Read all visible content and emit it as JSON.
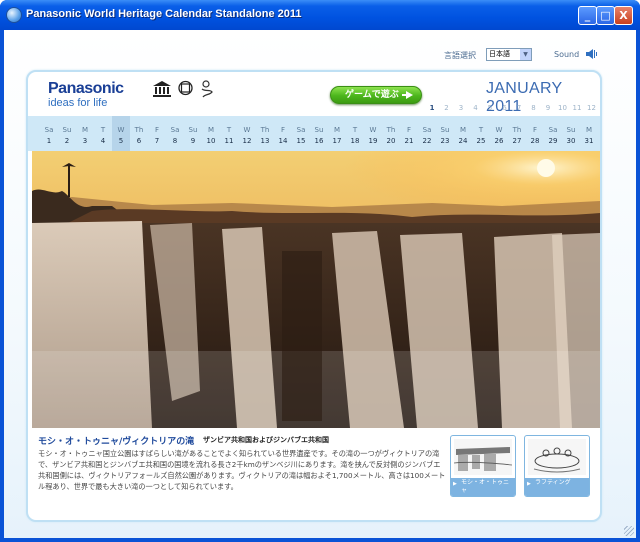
{
  "window": {
    "title": "Panasonic World Heritage Calendar Standalone 2011",
    "min_glyph": "_",
    "max_glyph": "□",
    "close_glyph": "X"
  },
  "header": {
    "lang_label": "言語選択",
    "lang_value": "日本語",
    "sound_label": "Sound"
  },
  "brand": {
    "name": "Panasonic",
    "tagline": "ideas for life",
    "icons": [
      "unesco-logo",
      "world-heritage-emblem",
      "education-logo"
    ]
  },
  "game_button": "ゲームで遊ぶ",
  "calendar": {
    "month_title": "JANUARY 2011",
    "months": [
      "1",
      "2",
      "3",
      "4",
      "5",
      "6",
      "7",
      "8",
      "9",
      "10",
      "11",
      "12"
    ],
    "active_month": "1",
    "days": [
      {
        "w": "Sa",
        "n": "1"
      },
      {
        "w": "Su",
        "n": "2"
      },
      {
        "w": "M",
        "n": "3"
      },
      {
        "w": "T",
        "n": "4"
      },
      {
        "w": "W",
        "n": "5",
        "hl": true
      },
      {
        "w": "Th",
        "n": "6"
      },
      {
        "w": "F",
        "n": "7"
      },
      {
        "w": "Sa",
        "n": "8"
      },
      {
        "w": "Su",
        "n": "9"
      },
      {
        "w": "M",
        "n": "10"
      },
      {
        "w": "T",
        "n": "11"
      },
      {
        "w": "W",
        "n": "12"
      },
      {
        "w": "Th",
        "n": "13"
      },
      {
        "w": "F",
        "n": "14"
      },
      {
        "w": "Sa",
        "n": "15"
      },
      {
        "w": "Su",
        "n": "16"
      },
      {
        "w": "M",
        "n": "17"
      },
      {
        "w": "T",
        "n": "18"
      },
      {
        "w": "W",
        "n": "19"
      },
      {
        "w": "Th",
        "n": "20"
      },
      {
        "w": "F",
        "n": "21"
      },
      {
        "w": "Sa",
        "n": "22"
      },
      {
        "w": "Su",
        "n": "23"
      },
      {
        "w": "M",
        "n": "24"
      },
      {
        "w": "T",
        "n": "25"
      },
      {
        "w": "W",
        "n": "26"
      },
      {
        "w": "Th",
        "n": "27"
      },
      {
        "w": "F",
        "n": "28"
      },
      {
        "w": "Sa",
        "n": "29"
      },
      {
        "w": "Su",
        "n": "30"
      },
      {
        "w": "M",
        "n": "31"
      }
    ]
  },
  "caption": {
    "title": "モシ・オ・トゥニャ/ヴィクトリアの滝",
    "country": "ザンビア共和国およびジンバブエ共和国",
    "body": "モシ・オ・トゥニャ国立公園はすばらしい滝があることでよく知られている世界遺産です。その滝の一つがヴィクトリアの滝で、ザンビア共和国とジンバブエ共和国の国境を流れる長さ2千kmのザンベジ川にあります。滝を挟んで反対側のジンバブエ共和国側には、ヴィクトリアフォールズ自然公園があります。ヴィクトリアの滝は幅およそ1,700メートル、高さは100メートル程あり、世界で最も大きい滝の一つとして知られています。"
  },
  "thumbnails": [
    {
      "label": "モシ・オ・トゥニャ"
    },
    {
      "label": "ラフティング"
    }
  ],
  "colors": {
    "titlebar": "#0a5fe8",
    "accent": "#3b6bb2",
    "daybar": "#cfe8f7",
    "game_button": "#4cb61c"
  }
}
